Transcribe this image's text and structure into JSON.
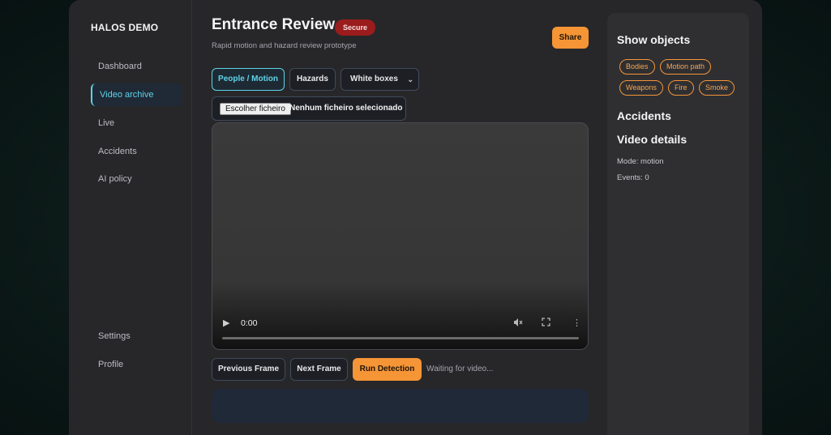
{
  "brand": "HALOS DEMO",
  "sidebar": {
    "items": [
      {
        "label": "Dashboard"
      },
      {
        "label": "Video archive"
      },
      {
        "label": "Live"
      },
      {
        "label": "Accidents"
      },
      {
        "label": "AI policy"
      }
    ],
    "bottom_items": [
      {
        "label": "Settings"
      },
      {
        "label": "Profile"
      }
    ],
    "active": "Video archive"
  },
  "header": {
    "title": "Entrance Review",
    "badge": "Secure",
    "subtitle": "Rapid motion and hazard review prototype",
    "share_label": "Share"
  },
  "modes": {
    "people_motion": "People / Motion",
    "hazards": "Hazards",
    "box_style": "White boxes"
  },
  "file_input": {
    "button_label": "Escolher ficheiro",
    "status": "Nenhum ficheiro selecionado"
  },
  "video": {
    "time": "0:00"
  },
  "controls": {
    "previous": "Previous Frame",
    "next": "Next Frame",
    "run": "Run Detection",
    "status": "Waiting for video..."
  },
  "panel": {
    "show_objects_title": "Show objects",
    "chips": [
      "Bodies",
      "Motion path",
      "Weapons",
      "Fire",
      "Smoke"
    ],
    "accidents_title": "Accidents",
    "video_details_title": "Video details",
    "mode": "Mode: motion",
    "events": "Events: 0"
  },
  "colors": {
    "accent_orange": "#f59536",
    "accent_cyan": "#5fd3e8",
    "secure_red": "#9b1c1c"
  }
}
